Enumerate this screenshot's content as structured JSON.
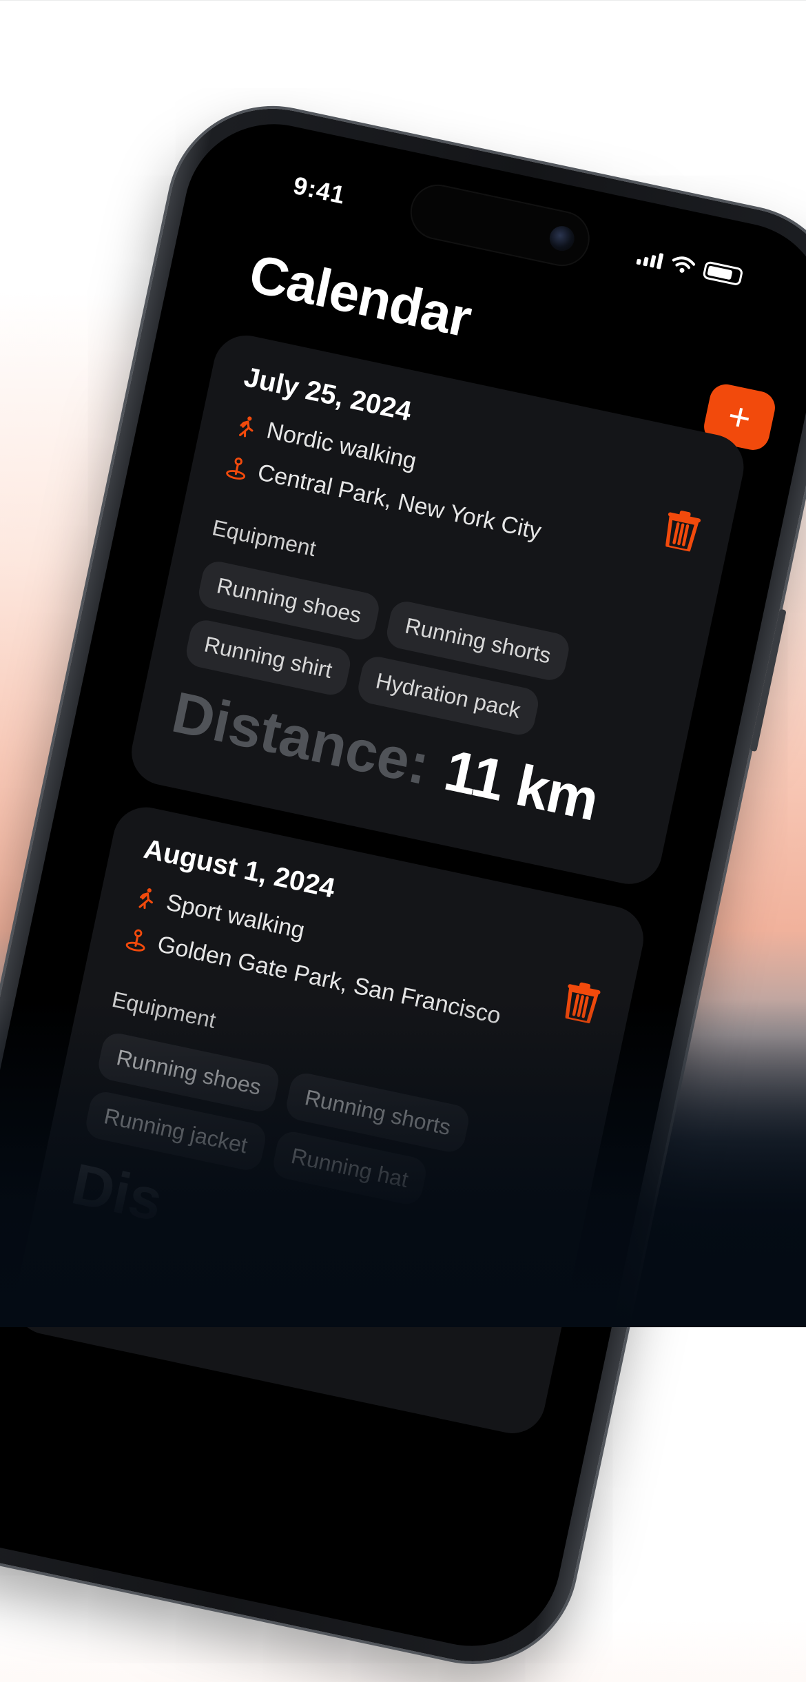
{
  "status_bar": {
    "time": "9:41"
  },
  "header": {
    "title": "Calendar",
    "add_label": "+"
  },
  "colors": {
    "accent": "#f24a0c",
    "card": "#141518",
    "chip": "#26272b"
  },
  "icons": {
    "activity": "walking-person-icon",
    "location": "map-pin-icon",
    "delete": "trash-icon",
    "add": "plus-icon"
  },
  "entries": [
    {
      "date": "July 25, 2024",
      "activity": "Nordic walking",
      "location": "Central Park, New York City",
      "equipment_label": "Equipment",
      "equipment": [
        "Running shoes",
        "Running shorts",
        "Running shirt",
        "Hydration pack"
      ],
      "distance_label": "Distance:",
      "distance_value": "11 km"
    },
    {
      "date": "August 1, 2024",
      "activity": "Sport walking",
      "location": "Golden Gate Park, San Francisco",
      "equipment_label": "Equipment",
      "equipment": [
        "Running shoes",
        "Running shorts",
        "Running jacket",
        "Running hat"
      ],
      "distance_label": "Dis"
    }
  ]
}
